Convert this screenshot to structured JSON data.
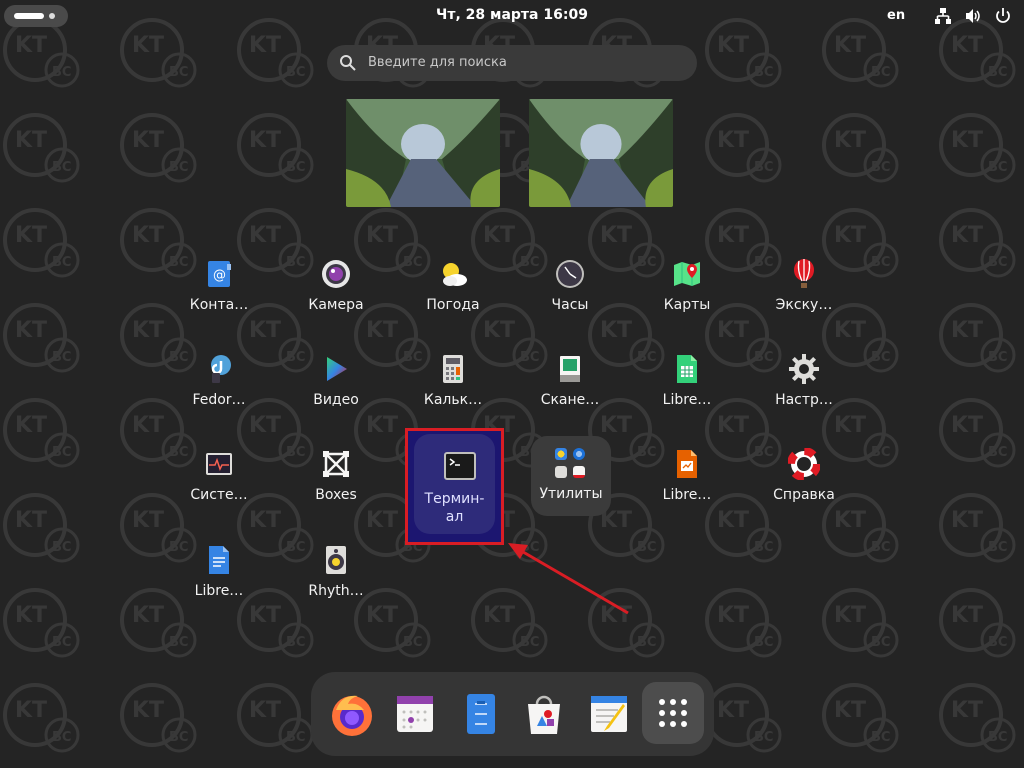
{
  "topbar": {
    "clock": "Чт, 28 марта  16:09",
    "language": "en"
  },
  "search": {
    "placeholder": "Введите для поиска"
  },
  "apps": [
    {
      "label": "Конта…",
      "icon": "contacts-icon"
    },
    {
      "label": "Камера",
      "icon": "camera-icon"
    },
    {
      "label": "Погода",
      "icon": "weather-icon"
    },
    {
      "label": "Часы",
      "icon": "clock-icon"
    },
    {
      "label": "Карты",
      "icon": "maps-icon"
    },
    {
      "label": "Экску…",
      "icon": "tour-balloon-icon"
    },
    {
      "label": "Fedor…",
      "icon": "fedora-icon"
    },
    {
      "label": "Видео",
      "icon": "video-play-icon"
    },
    {
      "label": "Кальк…",
      "icon": "calculator-icon"
    },
    {
      "label": "Скане…",
      "icon": "scanner-icon"
    },
    {
      "label": "Libre…",
      "icon": "libreoffice-calc-icon"
    },
    {
      "label": "Настр…",
      "icon": "settings-gear-icon"
    },
    {
      "label": "Систе…",
      "icon": "system-monitor-icon"
    },
    {
      "label": "Boxes",
      "icon": "boxes-icon"
    },
    {
      "label": "Термин-\nал",
      "icon": "terminal-icon"
    },
    {
      "label": "Утилиты",
      "icon": "utilities-folder-icon"
    },
    {
      "label": "Libre…",
      "icon": "libreoffice-impress-icon"
    },
    {
      "label": "Справка",
      "icon": "help-lifebuoy-icon"
    },
    {
      "label": "Libre…",
      "icon": "libreoffice-writer-icon"
    },
    {
      "label": "Rhyth…",
      "icon": "rhythmbox-icon"
    }
  ],
  "dock": [
    {
      "icon": "firefox-icon"
    },
    {
      "icon": "calendar-icon"
    },
    {
      "icon": "files-icon"
    },
    {
      "icon": "software-store-icon"
    },
    {
      "icon": "text-editor-icon"
    },
    {
      "icon": "show-apps-grid-icon"
    }
  ],
  "colors": {
    "background": "#242424",
    "highlight_border": "#d91d24",
    "terminal_selection": "#1c1670",
    "arrow": "#d91d24"
  }
}
